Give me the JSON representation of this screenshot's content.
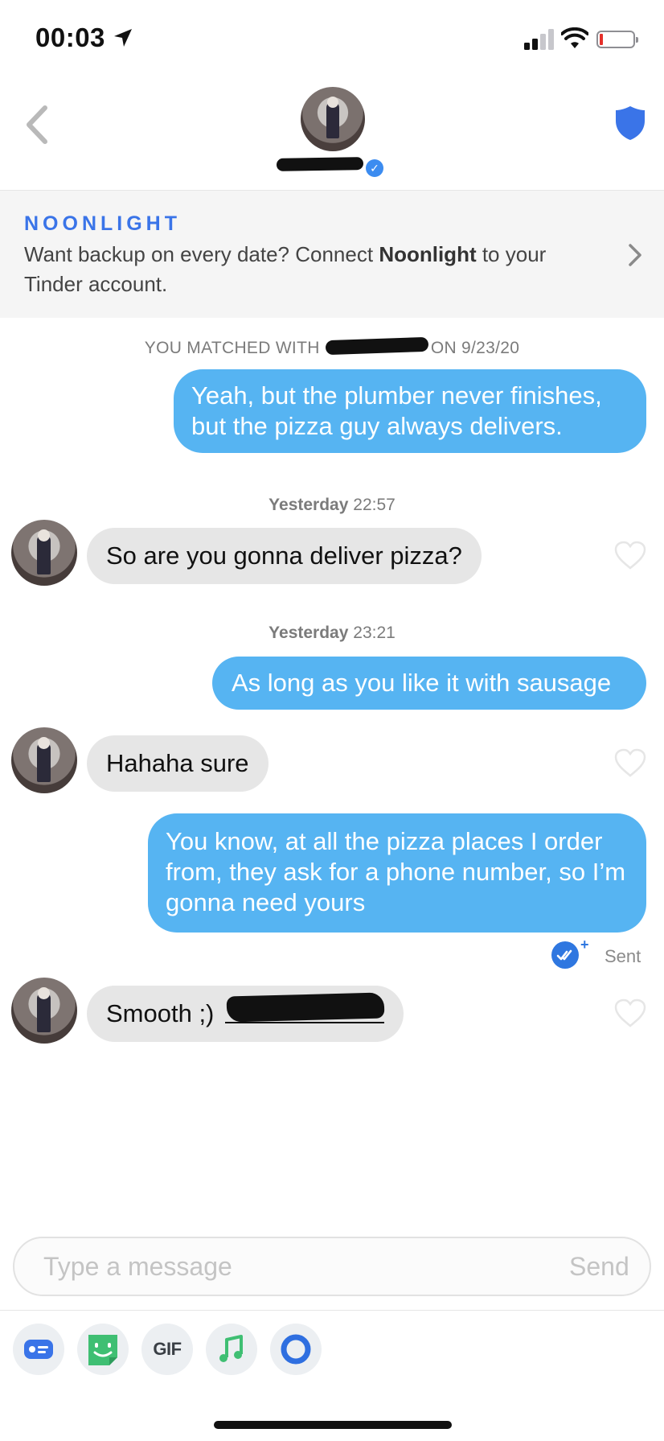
{
  "status_bar": {
    "time": "00:03"
  },
  "header": {
    "back_label": "back",
    "name_hidden": true
  },
  "banner": {
    "logo": "NOONLIGHT",
    "text_before": "Want backup on every date? Connect ",
    "text_bold": "Noonlight",
    "text_after": " to your Tinder account."
  },
  "match": {
    "prefix": "YOU MATCHED WITH",
    "suffix": "ON 9/23/20"
  },
  "messages": [
    {
      "from": "me",
      "text": "Yeah, but the plumber never finishes, but the pizza guy always delivers."
    },
    {
      "stamp_day": "Yesterday",
      "stamp_time": "22:57"
    },
    {
      "from": "them",
      "text": "So are you gonna deliver pizza?"
    },
    {
      "stamp_day": "Yesterday",
      "stamp_time": "23:21"
    },
    {
      "from": "me",
      "text": "As long as you like it with sausage"
    },
    {
      "from": "them",
      "text": "Hahaha sure"
    },
    {
      "from": "me",
      "text": "You know, at all the pizza places I order from, they ask for a phone number, so I’m gonna need yours",
      "status": "Sent"
    },
    {
      "from": "them",
      "text": "Smooth ;)"
    }
  ],
  "composer": {
    "placeholder": "Type a message",
    "send_label": "Send"
  },
  "toolbar": {
    "gif_label": "GIF",
    "tools": [
      "contact-card-icon",
      "sticker-icon",
      "gif-icon",
      "music-icon",
      "loop-icon"
    ]
  },
  "colors": {
    "outgoing": "#56b4f2",
    "incoming": "#e6e6e6",
    "brand": "#3a74e8"
  }
}
